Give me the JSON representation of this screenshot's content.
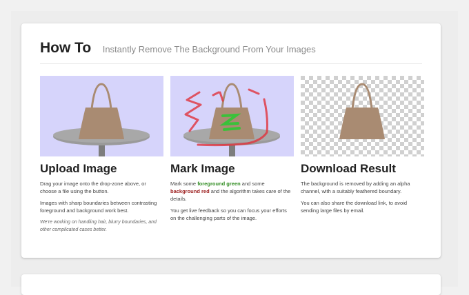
{
  "header": {
    "title": "How To",
    "subtitle": "Instantly Remove The Background From Your Images"
  },
  "steps": [
    {
      "title": "Upload Image",
      "paragraphs": [
        "Drag your image onto the drop-zone above, or choose a file using the button.",
        "Images with sharp boundaries between contrasting foreground and background work best."
      ],
      "note": "We're working on handling hair, blurry boundaries, and other complicated cases better."
    },
    {
      "title": "Mark Image",
      "p1_pre": "Mark some ",
      "p1_fg": "foreground green",
      "p1_mid": " and some ",
      "p1_bg": "background red",
      "p1_post": " and the algorithm takes care of the details.",
      "p2": "You get live feedback so you can focus your efforts on the challenging parts of the image."
    },
    {
      "title": "Download Result",
      "paragraphs": [
        "The background is removed by adding an alpha channel, with a suitably feathered boundary.",
        "You can also share the download link, to avoid sending large files by email."
      ]
    }
  ],
  "colors": {
    "image_bg": "#d6d4fb",
    "bag": "#a98b72",
    "table_top": "#9a9a9a",
    "mark_green": "#3ac13a",
    "mark_red": "#e0323c",
    "checker_light": "#ffffff",
    "checker_dark": "#d0d0d0"
  }
}
